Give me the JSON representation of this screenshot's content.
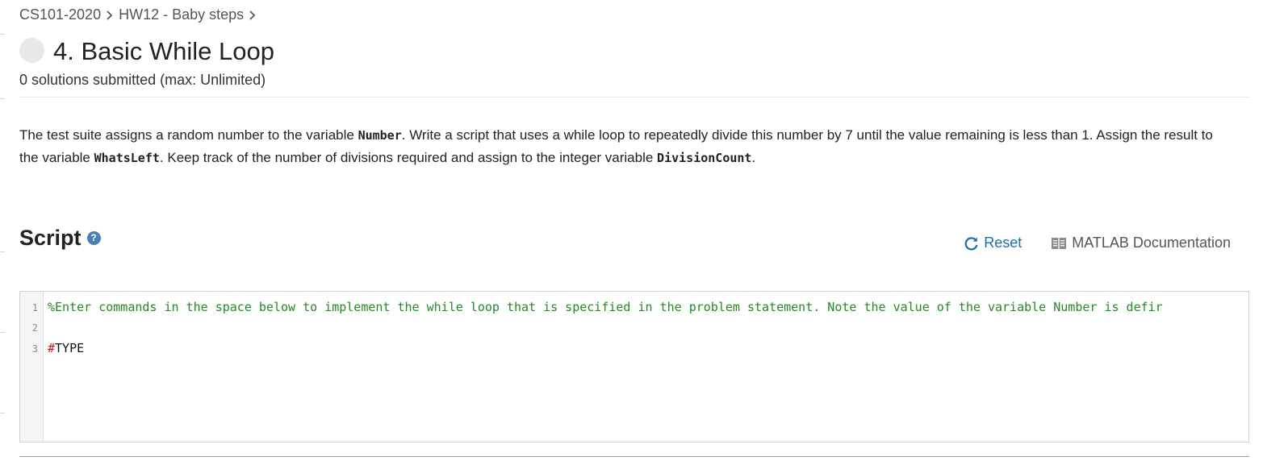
{
  "breadcrumb": {
    "course": "CS101-2020",
    "assignment": "HW12 - Baby steps"
  },
  "problem": {
    "title": "4. Basic While Loop",
    "submissions": "0 solutions submitted (max: Unlimited)"
  },
  "description": {
    "p1": "The test suite assigns a random number to the variable ",
    "var_number": "Number",
    "p2": ". Write a script that uses a while loop to repeatedly divide this number by 7 until the value remaining is less than 1. Assign the result to the variable ",
    "var_whatsleft": "WhatsLeft",
    "p3": ". Keep track of the number of divisions required and assign to the integer variable ",
    "var_divisioncount": "DivisionCount",
    "p4": "."
  },
  "script": {
    "heading": "Script",
    "help_icon_glyph": "?",
    "reset_label": "Reset",
    "doc_label": "MATLAB Documentation"
  },
  "editor": {
    "lines": [
      {
        "num": "1",
        "text": "%Enter commands in the space below to implement the while loop that is specified in the problem statement.   Note the value of the variable Number is defir"
      },
      {
        "num": "2",
        "text": ""
      },
      {
        "num": "3",
        "hash": "#",
        "text": "TYPE"
      }
    ]
  },
  "colors": {
    "link": "#1a6ea8",
    "comment": "#228b22",
    "hash": "#c21a1a",
    "help_icon": "#4a7fb0"
  },
  "icons": {
    "breadcrumb_separator": "chevron-right-icon",
    "help": "help-icon",
    "reset": "refresh-icon",
    "documentation": "book-icon"
  }
}
